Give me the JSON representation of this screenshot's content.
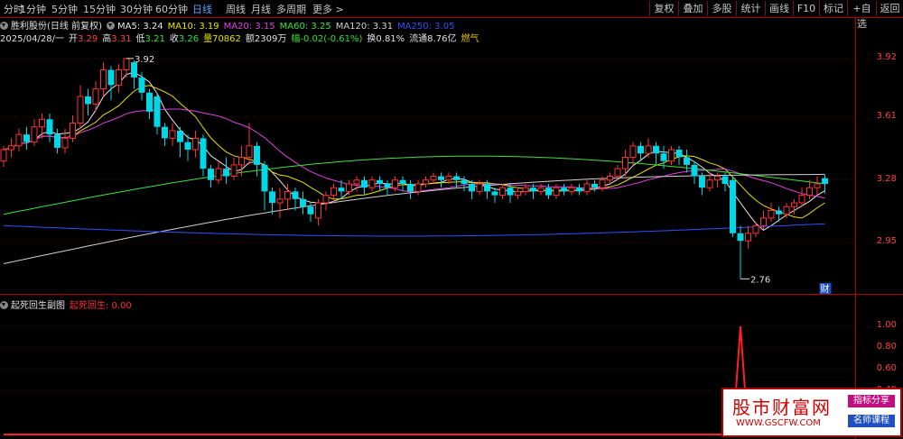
{
  "toolbar": {
    "periods": [
      "分时",
      "1分钟",
      "5分钟",
      "15分钟",
      "30分钟",
      "60分钟",
      "日线",
      "周线",
      "月线",
      "多周期",
      "更多 >"
    ],
    "active_period": "日线",
    "right_buttons": [
      "复权",
      "叠加",
      "多股",
      "统计",
      "画线",
      "F10",
      "标记",
      "+自选",
      "返回"
    ]
  },
  "info_line1": {
    "stock": "胜利股份(日线 前复权)",
    "ma": [
      {
        "label": "MA5: 3.24",
        "color": "#e8e8e8"
      },
      {
        "label": "MA10: 3.19",
        "color": "#e8e000"
      },
      {
        "label": "MA20: 3.15",
        "color": "#e040e0"
      },
      {
        "label": "MA60: 3.25",
        "color": "#40e040"
      },
      {
        "label": "MA120: 3.31",
        "color": "#d0d0d0"
      },
      {
        "label": "MA250: 3.05",
        "color": "#3050ff"
      }
    ]
  },
  "info_line2": {
    "date": "2025/04/28/一",
    "open_label": "开",
    "open": "3.29",
    "high_label": "高",
    "high": "3.31",
    "low_label": "低",
    "low": "3.21",
    "close_label": "收",
    "close": "3.26",
    "volume_label": "量",
    "volume": "70862",
    "amount": "额2309万",
    "change": "幅-0.02(-0.61%)",
    "turnover": "换0.81%",
    "float_cap": "流通8.76亿",
    "concept": "燃气"
  },
  "price_axis": [
    "3.92",
    "3.61",
    "3.28",
    "2.95"
  ],
  "price_annotations": {
    "high": "3.92",
    "low": "2.76",
    "event_badge": "财"
  },
  "sub_chart": {
    "title": "起死回生副图",
    "indicator_label": "起死回生: 0.00",
    "axis": [
      "1.00",
      "0.80",
      "0.60",
      "0.40"
    ]
  },
  "watermark": {
    "main": "股市财富网",
    "url": "WWW.GSCFW.COM",
    "tag1": "指标分享",
    "tag2": "名师课程"
  },
  "colors": {
    "up": "#ff3232",
    "down": "#00d8e8",
    "border": "#b00000",
    "grid": "#5a0000"
  },
  "chart_data": [
    {
      "type": "candlestick",
      "y_min": 2.7,
      "y_max": 4.0,
      "yticks": [
        3.92,
        3.61,
        3.28,
        2.95
      ],
      "candles": [
        [
          3.38,
          3.44,
          3.35,
          3.46
        ],
        [
          3.44,
          3.46,
          3.4,
          3.5
        ],
        [
          3.46,
          3.52,
          3.43,
          3.55
        ],
        [
          3.52,
          3.48,
          3.44,
          3.56
        ],
        [
          3.48,
          3.56,
          3.46,
          3.6
        ],
        [
          3.56,
          3.6,
          3.5,
          3.63
        ],
        [
          3.6,
          3.52,
          3.48,
          3.63
        ],
        [
          3.52,
          3.45,
          3.42,
          3.55
        ],
        [
          3.45,
          3.5,
          3.42,
          3.55
        ],
        [
          3.5,
          3.58,
          3.48,
          3.62
        ],
        [
          3.58,
          3.72,
          3.55,
          3.78
        ],
        [
          3.72,
          3.68,
          3.62,
          3.76
        ],
        [
          3.68,
          3.76,
          3.64,
          3.8
        ],
        [
          3.76,
          3.86,
          3.72,
          3.9
        ],
        [
          3.86,
          3.78,
          3.7,
          3.88
        ],
        [
          3.78,
          3.86,
          3.74,
          3.89
        ],
        [
          3.86,
          3.92,
          3.82,
          3.92
        ],
        [
          3.9,
          3.82,
          3.76,
          3.91
        ],
        [
          3.82,
          3.74,
          3.7,
          3.85
        ],
        [
          3.74,
          3.64,
          3.6,
          3.76
        ],
        [
          3.72,
          3.56,
          3.52,
          3.74
        ],
        [
          3.56,
          3.5,
          3.46,
          3.58
        ],
        [
          3.5,
          3.54,
          3.46,
          3.58
        ],
        [
          3.54,
          3.48,
          3.4,
          3.56
        ],
        [
          3.48,
          3.44,
          3.38,
          3.52
        ],
        [
          3.44,
          3.5,
          3.4,
          3.54
        ],
        [
          3.5,
          3.34,
          3.3,
          3.52
        ],
        [
          3.34,
          3.28,
          3.24,
          3.36
        ],
        [
          3.28,
          3.34,
          3.26,
          3.38
        ],
        [
          3.34,
          3.3,
          3.26,
          3.4
        ],
        [
          3.3,
          3.36,
          3.28,
          3.4
        ],
        [
          3.36,
          3.4,
          3.3,
          3.46
        ],
        [
          3.4,
          3.46,
          3.36,
          3.58
        ],
        [
          3.46,
          3.36,
          3.3,
          3.48
        ],
        [
          3.36,
          3.22,
          3.12,
          3.38
        ],
        [
          3.22,
          3.16,
          3.1,
          3.24
        ],
        [
          3.16,
          3.18,
          3.08,
          3.24
        ],
        [
          3.18,
          3.22,
          3.12,
          3.26
        ],
        [
          3.22,
          3.18,
          3.12,
          3.24
        ],
        [
          3.18,
          3.14,
          3.1,
          3.22
        ],
        [
          3.14,
          3.1,
          3.06,
          3.16
        ],
        [
          3.08,
          3.16,
          3.04,
          3.18
        ],
        [
          3.16,
          3.2,
          3.12,
          3.22
        ],
        [
          3.2,
          3.24,
          3.16,
          3.26
        ],
        [
          3.24,
          3.22,
          3.18,
          3.28
        ],
        [
          3.22,
          3.26,
          3.2,
          3.28
        ],
        [
          3.26,
          3.28,
          3.22,
          3.3
        ],
        [
          3.28,
          3.24,
          3.2,
          3.3
        ],
        [
          3.24,
          3.28,
          3.22,
          3.3
        ],
        [
          3.28,
          3.26,
          3.22,
          3.3
        ],
        [
          3.26,
          3.24,
          3.2,
          3.28
        ],
        [
          3.24,
          3.28,
          3.22,
          3.3
        ],
        [
          3.28,
          3.26,
          3.22,
          3.3
        ],
        [
          3.26,
          3.22,
          3.18,
          3.28
        ],
        [
          3.22,
          3.26,
          3.2,
          3.28
        ],
        [
          3.26,
          3.28,
          3.24,
          3.3
        ],
        [
          3.28,
          3.3,
          3.26,
          3.32
        ],
        [
          3.3,
          3.28,
          3.24,
          3.32
        ],
        [
          3.28,
          3.3,
          3.26,
          3.32
        ],
        [
          3.3,
          3.28,
          3.24,
          3.32
        ],
        [
          3.28,
          3.26,
          3.22,
          3.3
        ],
        [
          3.26,
          3.22,
          3.18,
          3.28
        ],
        [
          3.22,
          3.26,
          3.2,
          3.28
        ],
        [
          3.26,
          3.22,
          3.18,
          3.28
        ],
        [
          3.22,
          3.2,
          3.16,
          3.24
        ],
        [
          3.2,
          3.24,
          3.18,
          3.26
        ],
        [
          3.24,
          3.2,
          3.16,
          3.26
        ],
        [
          3.2,
          3.22,
          3.18,
          3.24
        ],
        [
          3.22,
          3.24,
          3.2,
          3.26
        ],
        [
          3.24,
          3.22,
          3.18,
          3.26
        ],
        [
          3.22,
          3.24,
          3.2,
          3.26
        ],
        [
          3.24,
          3.2,
          3.18,
          3.26
        ],
        [
          3.2,
          3.24,
          3.18,
          3.26
        ],
        [
          3.24,
          3.22,
          3.2,
          3.26
        ],
        [
          3.22,
          3.24,
          3.2,
          3.26
        ],
        [
          3.24,
          3.22,
          3.2,
          3.26
        ],
        [
          3.22,
          3.26,
          3.2,
          3.28
        ],
        [
          3.26,
          3.24,
          3.22,
          3.28
        ],
        [
          3.24,
          3.28,
          3.22,
          3.3
        ],
        [
          3.28,
          3.3,
          3.26,
          3.32
        ],
        [
          3.3,
          3.34,
          3.28,
          3.36
        ],
        [
          3.34,
          3.4,
          3.3,
          3.44
        ],
        [
          3.4,
          3.46,
          3.36,
          3.48
        ],
        [
          3.46,
          3.42,
          3.38,
          3.48
        ],
        [
          3.42,
          3.46,
          3.4,
          3.5
        ],
        [
          3.46,
          3.42,
          3.36,
          3.48
        ],
        [
          3.42,
          3.38,
          3.34,
          3.46
        ],
        [
          3.38,
          3.44,
          3.36,
          3.46
        ],
        [
          3.44,
          3.4,
          3.36,
          3.46
        ],
        [
          3.4,
          3.36,
          3.32,
          3.44
        ],
        [
          3.36,
          3.3,
          3.26,
          3.38
        ],
        [
          3.3,
          3.24,
          3.2,
          3.32
        ],
        [
          3.24,
          3.28,
          3.22,
          3.32
        ],
        [
          3.28,
          3.3,
          3.24,
          3.32
        ],
        [
          3.3,
          3.26,
          3.22,
          3.32
        ],
        [
          3.28,
          3.0,
          2.98,
          3.3
        ],
        [
          3.0,
          2.96,
          2.76,
          3.04
        ],
        [
          2.96,
          3.0,
          2.92,
          3.04
        ],
        [
          3.0,
          3.04,
          2.98,
          3.06
        ],
        [
          3.04,
          3.08,
          3.02,
          3.12
        ],
        [
          3.08,
          3.12,
          3.06,
          3.16
        ],
        [
          3.12,
          3.1,
          3.06,
          3.14
        ],
        [
          3.1,
          3.14,
          3.08,
          3.16
        ],
        [
          3.14,
          3.16,
          3.1,
          3.18
        ],
        [
          3.16,
          3.2,
          3.14,
          3.24
        ],
        [
          3.2,
          3.24,
          3.18,
          3.28
        ],
        [
          3.24,
          3.26,
          3.2,
          3.3
        ],
        [
          3.29,
          3.26,
          3.21,
          3.31
        ]
      ]
    },
    {
      "type": "line",
      "name": "起死回生",
      "y_min": 0,
      "y_max": 1.2,
      "values": [
        0,
        0,
        0,
        0,
        0,
        0,
        0,
        0,
        0,
        0,
        0,
        0,
        0,
        0,
        0,
        0,
        0,
        0,
        0,
        0,
        0,
        0,
        0,
        0,
        0,
        0,
        0,
        0,
        0,
        0,
        0,
        0,
        0,
        0,
        0,
        0,
        0,
        0,
        0,
        0,
        0,
        0,
        0,
        0,
        0,
        0,
        0,
        0,
        0,
        0,
        0,
        0,
        0,
        0,
        0,
        0,
        0,
        0,
        0,
        0,
        0,
        0,
        0,
        0,
        0,
        0,
        0,
        0,
        0,
        0,
        0,
        0,
        0,
        0,
        0,
        0,
        0,
        0,
        0,
        0,
        0,
        0,
        0,
        0,
        0,
        0,
        0,
        0,
        0,
        0,
        0,
        0,
        0,
        0,
        0,
        0,
        1,
        0,
        0,
        0,
        0,
        0,
        0,
        0,
        0,
        0,
        0,
        0
      ]
    }
  ]
}
